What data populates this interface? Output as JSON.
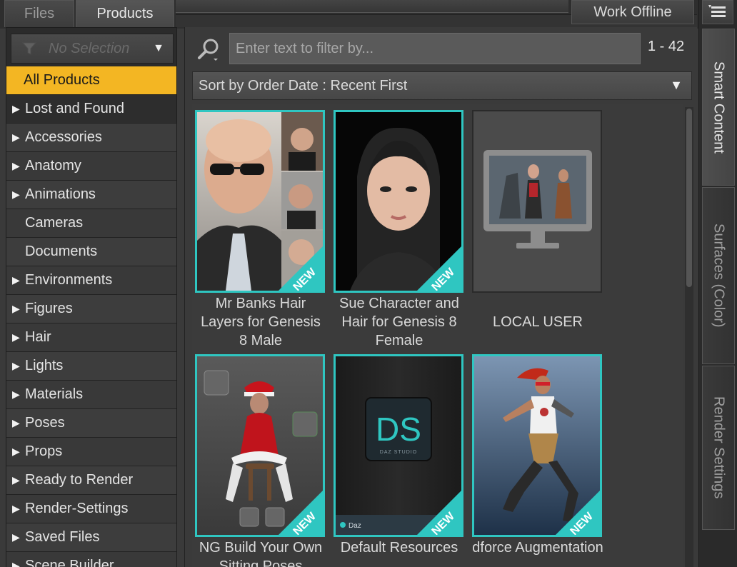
{
  "tabs": {
    "files": "Files",
    "products": "Products"
  },
  "work_offline": "Work Offline",
  "selector": {
    "placeholder": "No Selection"
  },
  "categories": [
    {
      "label": "All Products",
      "expandable": false,
      "selected": true
    },
    {
      "label": "Lost and Found",
      "expandable": true
    },
    {
      "label": "Accessories",
      "expandable": true
    },
    {
      "label": "Anatomy",
      "expandable": true
    },
    {
      "label": "Animations",
      "expandable": true
    },
    {
      "label": "Cameras",
      "expandable": false
    },
    {
      "label": "Documents",
      "expandable": false
    },
    {
      "label": "Environments",
      "expandable": true
    },
    {
      "label": "Figures",
      "expandable": true
    },
    {
      "label": "Hair",
      "expandable": true
    },
    {
      "label": "Lights",
      "expandable": true
    },
    {
      "label": "Materials",
      "expandable": true
    },
    {
      "label": "Poses",
      "expandable": true
    },
    {
      "label": "Props",
      "expandable": true
    },
    {
      "label": "Ready to Render",
      "expandable": true
    },
    {
      "label": "Render-Settings",
      "expandable": true
    },
    {
      "label": "Saved Files",
      "expandable": true
    },
    {
      "label": "Scene Builder",
      "expandable": true
    }
  ],
  "search": {
    "placeholder": "Enter text to filter by...",
    "count": "1 - 42"
  },
  "sort": {
    "label": "Sort by Order Date : Recent First"
  },
  "products": [
    {
      "title": "Mr Banks Hair Layers for Genesis 8 Male",
      "badge": "NEW"
    },
    {
      "title": "Sue Character and Hair for Genesis 8 Female",
      "badge": "NEW"
    },
    {
      "title": "LOCAL USER",
      "badge": ""
    },
    {
      "title": "NG Build Your Own Sitting Poses",
      "badge": "NEW"
    },
    {
      "title": "Default Resources",
      "badge": "NEW",
      "logo_text": "DS",
      "logo_sub": "DAZ STUDIO",
      "brand": "Daz"
    },
    {
      "title": "dforce Augmentation",
      "badge": "NEW"
    }
  ],
  "right_tabs": [
    "Smart Content",
    "Surfaces (Color)",
    "Render Settings"
  ],
  "colors": {
    "accent_selected": "#f3b623",
    "card_border": "#2fc6c1",
    "badge": "#2fc6c1"
  }
}
